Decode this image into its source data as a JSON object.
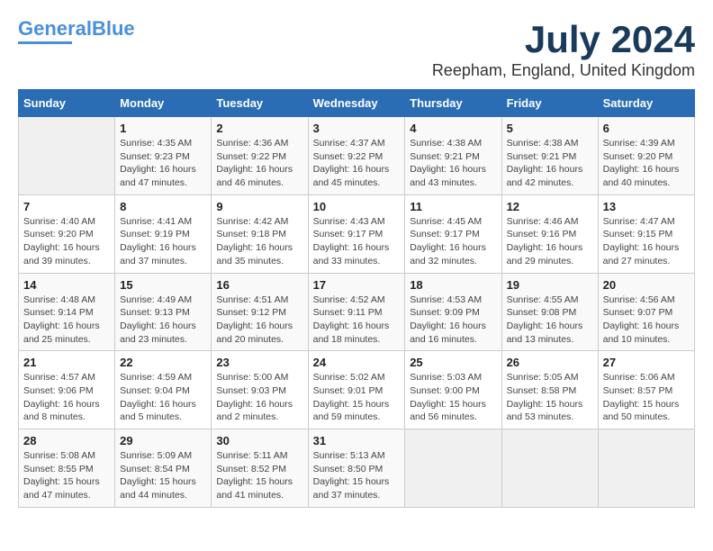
{
  "header": {
    "logo_line1": "General",
    "logo_line2": "Blue",
    "month": "July 2024",
    "location": "Reepham, England, United Kingdom"
  },
  "weekdays": [
    "Sunday",
    "Monday",
    "Tuesday",
    "Wednesday",
    "Thursday",
    "Friday",
    "Saturday"
  ],
  "weeks": [
    [
      {
        "day": "",
        "info": ""
      },
      {
        "day": "1",
        "info": "Sunrise: 4:35 AM\nSunset: 9:23 PM\nDaylight: 16 hours\nand 47 minutes."
      },
      {
        "day": "2",
        "info": "Sunrise: 4:36 AM\nSunset: 9:22 PM\nDaylight: 16 hours\nand 46 minutes."
      },
      {
        "day": "3",
        "info": "Sunrise: 4:37 AM\nSunset: 9:22 PM\nDaylight: 16 hours\nand 45 minutes."
      },
      {
        "day": "4",
        "info": "Sunrise: 4:38 AM\nSunset: 9:21 PM\nDaylight: 16 hours\nand 43 minutes."
      },
      {
        "day": "5",
        "info": "Sunrise: 4:38 AM\nSunset: 9:21 PM\nDaylight: 16 hours\nand 42 minutes."
      },
      {
        "day": "6",
        "info": "Sunrise: 4:39 AM\nSunset: 9:20 PM\nDaylight: 16 hours\nand 40 minutes."
      }
    ],
    [
      {
        "day": "7",
        "info": "Sunrise: 4:40 AM\nSunset: 9:20 PM\nDaylight: 16 hours\nand 39 minutes."
      },
      {
        "day": "8",
        "info": "Sunrise: 4:41 AM\nSunset: 9:19 PM\nDaylight: 16 hours\nand 37 minutes."
      },
      {
        "day": "9",
        "info": "Sunrise: 4:42 AM\nSunset: 9:18 PM\nDaylight: 16 hours\nand 35 minutes."
      },
      {
        "day": "10",
        "info": "Sunrise: 4:43 AM\nSunset: 9:17 PM\nDaylight: 16 hours\nand 33 minutes."
      },
      {
        "day": "11",
        "info": "Sunrise: 4:45 AM\nSunset: 9:17 PM\nDaylight: 16 hours\nand 32 minutes."
      },
      {
        "day": "12",
        "info": "Sunrise: 4:46 AM\nSunset: 9:16 PM\nDaylight: 16 hours\nand 29 minutes."
      },
      {
        "day": "13",
        "info": "Sunrise: 4:47 AM\nSunset: 9:15 PM\nDaylight: 16 hours\nand 27 minutes."
      }
    ],
    [
      {
        "day": "14",
        "info": "Sunrise: 4:48 AM\nSunset: 9:14 PM\nDaylight: 16 hours\nand 25 minutes."
      },
      {
        "day": "15",
        "info": "Sunrise: 4:49 AM\nSunset: 9:13 PM\nDaylight: 16 hours\nand 23 minutes."
      },
      {
        "day": "16",
        "info": "Sunrise: 4:51 AM\nSunset: 9:12 PM\nDaylight: 16 hours\nand 20 minutes."
      },
      {
        "day": "17",
        "info": "Sunrise: 4:52 AM\nSunset: 9:11 PM\nDaylight: 16 hours\nand 18 minutes."
      },
      {
        "day": "18",
        "info": "Sunrise: 4:53 AM\nSunset: 9:09 PM\nDaylight: 16 hours\nand 16 minutes."
      },
      {
        "day": "19",
        "info": "Sunrise: 4:55 AM\nSunset: 9:08 PM\nDaylight: 16 hours\nand 13 minutes."
      },
      {
        "day": "20",
        "info": "Sunrise: 4:56 AM\nSunset: 9:07 PM\nDaylight: 16 hours\nand 10 minutes."
      }
    ],
    [
      {
        "day": "21",
        "info": "Sunrise: 4:57 AM\nSunset: 9:06 PM\nDaylight: 16 hours\nand 8 minutes."
      },
      {
        "day": "22",
        "info": "Sunrise: 4:59 AM\nSunset: 9:04 PM\nDaylight: 16 hours\nand 5 minutes."
      },
      {
        "day": "23",
        "info": "Sunrise: 5:00 AM\nSunset: 9:03 PM\nDaylight: 16 hours\nand 2 minutes."
      },
      {
        "day": "24",
        "info": "Sunrise: 5:02 AM\nSunset: 9:01 PM\nDaylight: 15 hours\nand 59 minutes."
      },
      {
        "day": "25",
        "info": "Sunrise: 5:03 AM\nSunset: 9:00 PM\nDaylight: 15 hours\nand 56 minutes."
      },
      {
        "day": "26",
        "info": "Sunrise: 5:05 AM\nSunset: 8:58 PM\nDaylight: 15 hours\nand 53 minutes."
      },
      {
        "day": "27",
        "info": "Sunrise: 5:06 AM\nSunset: 8:57 PM\nDaylight: 15 hours\nand 50 minutes."
      }
    ],
    [
      {
        "day": "28",
        "info": "Sunrise: 5:08 AM\nSunset: 8:55 PM\nDaylight: 15 hours\nand 47 minutes."
      },
      {
        "day": "29",
        "info": "Sunrise: 5:09 AM\nSunset: 8:54 PM\nDaylight: 15 hours\nand 44 minutes."
      },
      {
        "day": "30",
        "info": "Sunrise: 5:11 AM\nSunset: 8:52 PM\nDaylight: 15 hours\nand 41 minutes."
      },
      {
        "day": "31",
        "info": "Sunrise: 5:13 AM\nSunset: 8:50 PM\nDaylight: 15 hours\nand 37 minutes."
      },
      {
        "day": "",
        "info": ""
      },
      {
        "day": "",
        "info": ""
      },
      {
        "day": "",
        "info": ""
      }
    ]
  ]
}
